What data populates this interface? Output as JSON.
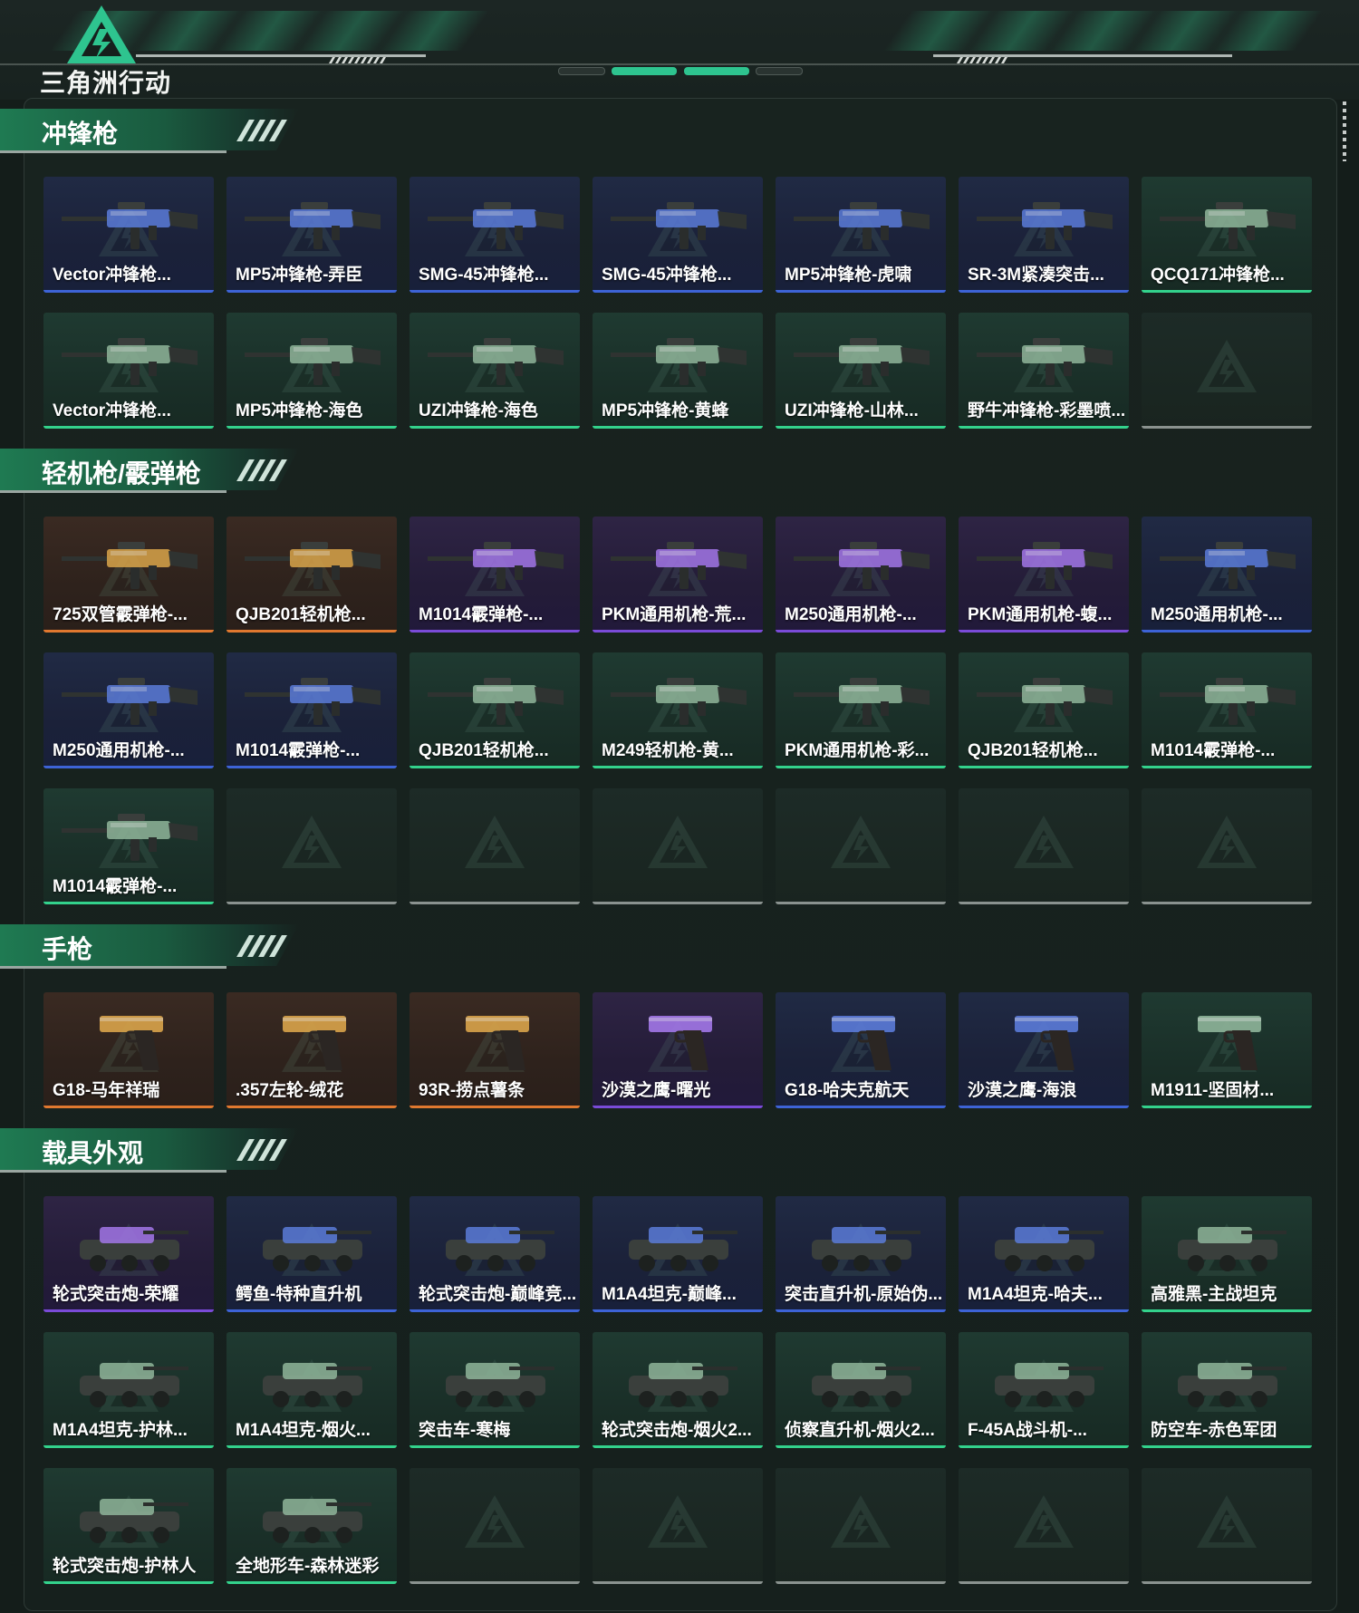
{
  "brand": {
    "name": "三角洲行动"
  },
  "sections": [
    {
      "title": "冲锋枪",
      "items": [
        {
          "label": "Vector冲锋枪...",
          "rarity": "blue"
        },
        {
          "label": "MP5冲锋枪-弄臣",
          "rarity": "blue"
        },
        {
          "label": "SMG-45冲锋枪...",
          "rarity": "blue"
        },
        {
          "label": "SMG-45冲锋枪...",
          "rarity": "blue"
        },
        {
          "label": "MP5冲锋枪-虎啸",
          "rarity": "blue"
        },
        {
          "label": "SR-3M紧凑突击...",
          "rarity": "blue"
        },
        {
          "label": "QCQ171冲锋枪...",
          "rarity": "green"
        },
        {
          "label": "Vector冲锋枪...",
          "rarity": "green"
        },
        {
          "label": "MP5冲锋枪-海色",
          "rarity": "green"
        },
        {
          "label": "UZI冲锋枪-海色",
          "rarity": "green"
        },
        {
          "label": "MP5冲锋枪-黄蜂",
          "rarity": "green"
        },
        {
          "label": "UZI冲锋枪-山林...",
          "rarity": "green"
        },
        {
          "label": "野牛冲锋枪-彩墨喷...",
          "rarity": "green"
        },
        {
          "label": "",
          "rarity": "empty"
        }
      ]
    },
    {
      "title": "轻机枪/霰弹枪",
      "items": [
        {
          "label": "725双管霰弹枪-...",
          "rarity": "orange"
        },
        {
          "label": "QJB201轻机枪...",
          "rarity": "orange"
        },
        {
          "label": "M1014霰弹枪-...",
          "rarity": "purple"
        },
        {
          "label": "PKM通用机枪-荒...",
          "rarity": "purple"
        },
        {
          "label": "M250通用机枪-...",
          "rarity": "purple"
        },
        {
          "label": "PKM通用机枪-蝮...",
          "rarity": "purple"
        },
        {
          "label": "M250通用机枪-...",
          "rarity": "blue"
        },
        {
          "label": "M250通用机枪-...",
          "rarity": "blue"
        },
        {
          "label": "M1014霰弹枪-...",
          "rarity": "blue"
        },
        {
          "label": "QJB201轻机枪...",
          "rarity": "green"
        },
        {
          "label": "M249轻机枪-黄...",
          "rarity": "green"
        },
        {
          "label": "PKM通用机枪-彩...",
          "rarity": "green"
        },
        {
          "label": "QJB201轻机枪...",
          "rarity": "green"
        },
        {
          "label": "M1014霰弹枪-...",
          "rarity": "green"
        },
        {
          "label": "M1014霰弹枪-...",
          "rarity": "green"
        },
        {
          "label": "",
          "rarity": "empty"
        },
        {
          "label": "",
          "rarity": "empty"
        },
        {
          "label": "",
          "rarity": "empty"
        },
        {
          "label": "",
          "rarity": "empty"
        },
        {
          "label": "",
          "rarity": "empty"
        },
        {
          "label": "",
          "rarity": "empty"
        }
      ]
    },
    {
      "title": "手枪",
      "items": [
        {
          "label": "G18-马年祥瑞",
          "rarity": "orange"
        },
        {
          "label": ".357左轮-绒花",
          "rarity": "orange"
        },
        {
          "label": "93R-捞点薯条",
          "rarity": "orange"
        },
        {
          "label": "沙漠之鹰-曙光",
          "rarity": "purple"
        },
        {
          "label": "G18-哈夫克航天",
          "rarity": "blue"
        },
        {
          "label": "沙漠之鹰-海浪",
          "rarity": "blue"
        },
        {
          "label": "M1911-坚固材...",
          "rarity": "green"
        }
      ]
    },
    {
      "title": "载具外观",
      "items": [
        {
          "label": "轮式突击炮-荣耀",
          "rarity": "purple"
        },
        {
          "label": "鳄鱼-特种直升机",
          "rarity": "blue"
        },
        {
          "label": "轮式突击炮-巅峰竞...",
          "rarity": "blue"
        },
        {
          "label": "M1A4坦克-巅峰...",
          "rarity": "blue"
        },
        {
          "label": "突击直升机-原始伪...",
          "rarity": "blue"
        },
        {
          "label": "M1A4坦克-哈夫...",
          "rarity": "blue"
        },
        {
          "label": "高雅黑-主战坦克",
          "rarity": "green"
        },
        {
          "label": "M1A4坦克-护林...",
          "rarity": "green"
        },
        {
          "label": "M1A4坦克-烟火...",
          "rarity": "green"
        },
        {
          "label": "突击车-寒梅",
          "rarity": "green"
        },
        {
          "label": "轮式突击炮-烟火2...",
          "rarity": "green"
        },
        {
          "label": "侦察直升机-烟火2...",
          "rarity": "green"
        },
        {
          "label": "F-45A战斗机-...",
          "rarity": "green"
        },
        {
          "label": "防空车-赤色军团",
          "rarity": "green"
        },
        {
          "label": "轮式突击炮-护林人",
          "rarity": "green"
        },
        {
          "label": "全地形车-森林迷彩",
          "rarity": "green"
        },
        {
          "label": "",
          "rarity": "empty"
        },
        {
          "label": "",
          "rarity": "empty"
        },
        {
          "label": "",
          "rarity": "empty"
        },
        {
          "label": "",
          "rarity": "empty"
        },
        {
          "label": "",
          "rarity": "empty"
        }
      ]
    }
  ],
  "colors": {
    "accent": "#2ec48f",
    "blue": "#3d63d6",
    "green": "#33d28c",
    "purple": "#7a4bd8",
    "orange": "#e0782f"
  }
}
